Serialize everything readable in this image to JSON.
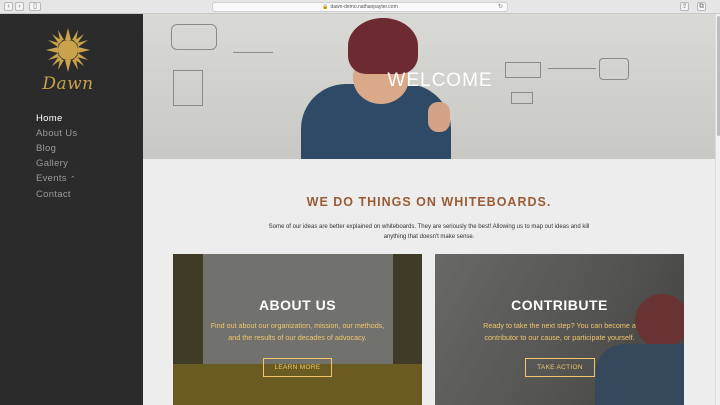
{
  "browser": {
    "url": "dawn-demo.nathanpayter.com"
  },
  "sidebar": {
    "logo_text": "Dawn",
    "nav": [
      {
        "label": "Home",
        "active": true
      },
      {
        "label": "About Us",
        "active": false
      },
      {
        "label": "Blog",
        "active": false
      },
      {
        "label": "Gallery",
        "active": false
      },
      {
        "label": "Events",
        "active": false,
        "chevron": "⌃"
      },
      {
        "label": "Contact",
        "active": false
      }
    ]
  },
  "hero": {
    "title": "WELCOME"
  },
  "main": {
    "section_title": "WE DO THINGS ON WHITEBOARDS.",
    "intro": "Some of our ideas are better explained on whiteboards. They are seriously the best! Allowing us to map out ideas and kill anything that doesn't make sense.",
    "cards": [
      {
        "title": "ABOUT US",
        "text": "Find out about our organization, mission, our methods, and the results of our decades of advocacy.",
        "button": "LEARN MORE"
      },
      {
        "title": "CONTRIBUTE",
        "text": "Ready to take the next step? You can become a contributor to our cause, or participate yourself.",
        "button": "TAKE ACTION"
      }
    ]
  },
  "colors": {
    "sidebar_bg": "#2b2b2b",
    "accent": "#9a5c34",
    "card_text": "#f2c66b",
    "logo": "#c9a24b"
  },
  "icons": [
    "back-icon",
    "forward-icon",
    "sidebar-toggle-icon",
    "lock-icon",
    "reload-icon",
    "share-icon",
    "tabs-icon",
    "sun-logo-icon"
  ]
}
